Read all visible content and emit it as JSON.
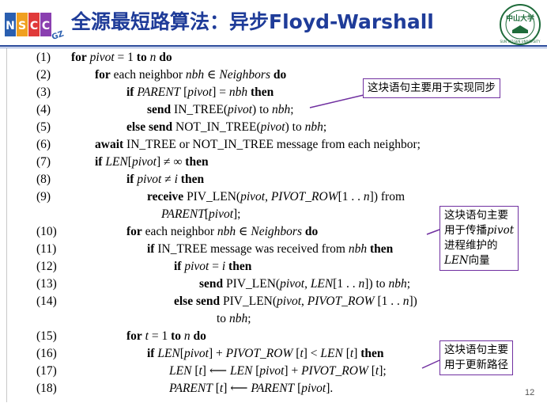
{
  "header": {
    "title": "全源最短路算法：异步Floyd-Warshall",
    "logo_text": "NSCC GZ",
    "seal_text": "中山大学 SUN YAT-SEN UNIVERSITY"
  },
  "lines": [
    {
      "n": "(1)",
      "html": "<b>for</b> <i>pivot</i> = 1 <b>to</b> <i>n</i> <b>do</b>"
    },
    {
      "n": "(2)",
      "html": "<b>for</b> each neighbor <i>nbh</i> ∈ <i>Neighbors</i> <b>do</b>"
    },
    {
      "n": "(3)",
      "html": "<b>if</b> <i>PARENT</i> [<i>pivot</i>] = <i>nbh</i> <b>then</b>"
    },
    {
      "n": "(4)",
      "html": "<b>send</b> IN_TREE(<i>pivot</i>) to <i>nbh</i>;"
    },
    {
      "n": "(5)",
      "html": "<b>else send</b> NOT_IN_TREE(<i>pivot</i>) to <i>nbh</i>;"
    },
    {
      "n": "(6)",
      "html": "<b>await</b> IN_TREE or NOT_IN_TREE message from each neighbor;"
    },
    {
      "n": "(7)",
      "html": "<b>if</b> <i>LEN</i>[<i>pivot</i>] ≠ ∞ <b>then</b>"
    },
    {
      "n": "(8)",
      "html": "<b>if</b> <i>pivot</i> ≠ <i>i</i> <b>then</b>"
    },
    {
      "n": "(9)",
      "html": "<b>receive</b> PIV_LEN(<i>pivot</i>, <i>PIVOT_ROW</i>[1 . . <i>n</i>]) from"
    },
    {
      "n": "",
      "html": "<i>PARENT</i>[<i>pivot</i>];"
    },
    {
      "n": "(10)",
      "html": "<b>for</b> each neighbor <i>nbh</i> ∈ <i>Neighbors</i> <b>do</b>"
    },
    {
      "n": "(11)",
      "html": "<b>if</b> IN_TREE message was received from <i>nbh</i> <b>then</b>"
    },
    {
      "n": "(12)",
      "html": "<b>if</b> <i>pivot</i> = <i>i</i> <b>then</b>"
    },
    {
      "n": "(13)",
      "html": "<b>send</b> PIV_LEN(<i>pivot</i>, <i>LEN</i>[1 . . <i>n</i>]) to <i>nbh</i>;"
    },
    {
      "n": "(14)",
      "html": "<b>else send</b> PIV_LEN(<i>pivot</i>, <i>PIVOT_ROW</i> [1 . . <i>n</i>])"
    },
    {
      "n": "",
      "html": "to <i>nbh</i>;"
    },
    {
      "n": "(15)",
      "html": "<b>for</b> <i>t</i> = 1 <b>to</b> <i>n</i> <b>do</b>"
    },
    {
      "n": "(16)",
      "html": "<b>if</b> <i>LEN</i>[<i>pivot</i>] + <i>PIVOT_ROW</i> [<i>t</i>] &lt; <i>LEN</i> [<i>t</i>] <b>then</b>"
    },
    {
      "n": "(17)",
      "html": "<i>LEN</i> [<i>t</i>] ⟵ <i>LEN</i> [<i>pivot</i>] + <i>PIVOT_ROW</i> [<i>t</i>];"
    },
    {
      "n": "(18)",
      "html": "<i>PARENT</i> [<i>t</i>] ⟵ <i>PARENT</i> [<i>pivot</i>]."
    }
  ],
  "notes": [
    {
      "html": "这块语句主要用于实现同步"
    },
    {
      "html": "这块语句主要<br>用于传播<span class=\"it\">pivot</span><br>进程维护的<br><span class=\"it\">LEN</span>向量"
    },
    {
      "html": "这块语句主要<br>用于更新路径"
    }
  ],
  "page_number": "12"
}
